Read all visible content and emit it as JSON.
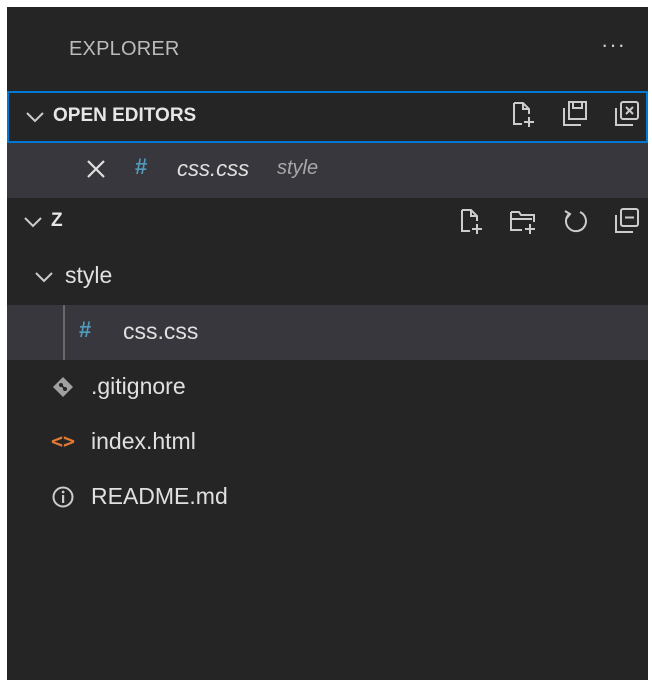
{
  "explorer": {
    "title": "EXPLORER",
    "more_icon": "ellipsis-icon"
  },
  "open_editors": {
    "label": "OPEN EDITORS",
    "actions": [
      "new-file-icon",
      "save-all-icon",
      "close-all-icon"
    ],
    "items": [
      {
        "name": "css.css",
        "description": "style",
        "icon": "css-hash-icon"
      }
    ]
  },
  "workspace": {
    "label": "Z",
    "actions": [
      "new-file-icon",
      "new-folder-icon",
      "refresh-icon",
      "collapse-all-icon"
    ],
    "folder": {
      "name": "style",
      "children": [
        {
          "name": "css.css"
        }
      ]
    },
    "files": [
      {
        "name": ".gitignore",
        "icon": "git-icon"
      },
      {
        "name": "index.html",
        "icon": "html-icon"
      },
      {
        "name": "README.md",
        "icon": "info-icon"
      }
    ]
  },
  "colors": {
    "background": "#252526",
    "selection": "#37373d",
    "focus_border": "#0078d4",
    "css_icon": "#519aba",
    "html_icon": "#e37933"
  }
}
